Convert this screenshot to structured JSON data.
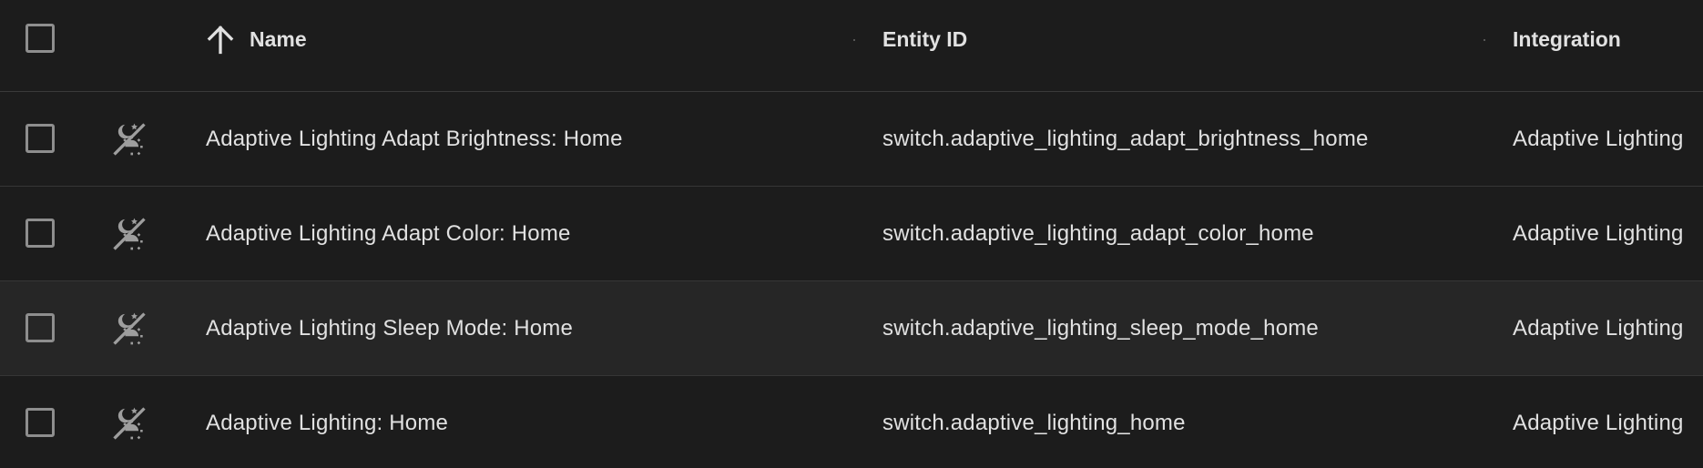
{
  "header": {
    "name_label": "Name",
    "entity_id_label": "Entity ID",
    "integration_label": "Integration"
  },
  "rows": [
    {
      "name": "Adaptive Lighting Adapt Brightness: Home",
      "entity_id": "switch.adaptive_lighting_adapt_brightness_home",
      "integration": "Adaptive Lighting",
      "icon": "sleep-sun-off-icon"
    },
    {
      "name": "Adaptive Lighting Adapt Color: Home",
      "entity_id": "switch.adaptive_lighting_adapt_color_home",
      "integration": "Adaptive Lighting",
      "icon": "sleep-sun-off-icon"
    },
    {
      "name": "Adaptive Lighting Sleep Mode: Home",
      "entity_id": "switch.adaptive_lighting_sleep_mode_home",
      "integration": "Adaptive Lighting",
      "icon": "sleep-sun-off-icon"
    },
    {
      "name": "Adaptive Lighting: Home",
      "entity_id": "switch.adaptive_lighting_home",
      "integration": "Adaptive Lighting",
      "icon": "sleep-sun-off-icon"
    }
  ],
  "colors": {
    "background": "#1c1c1c",
    "hover_row": "#262626",
    "text": "#e1e1e1",
    "icon": "#9e9e9e",
    "divider": "#363636"
  }
}
